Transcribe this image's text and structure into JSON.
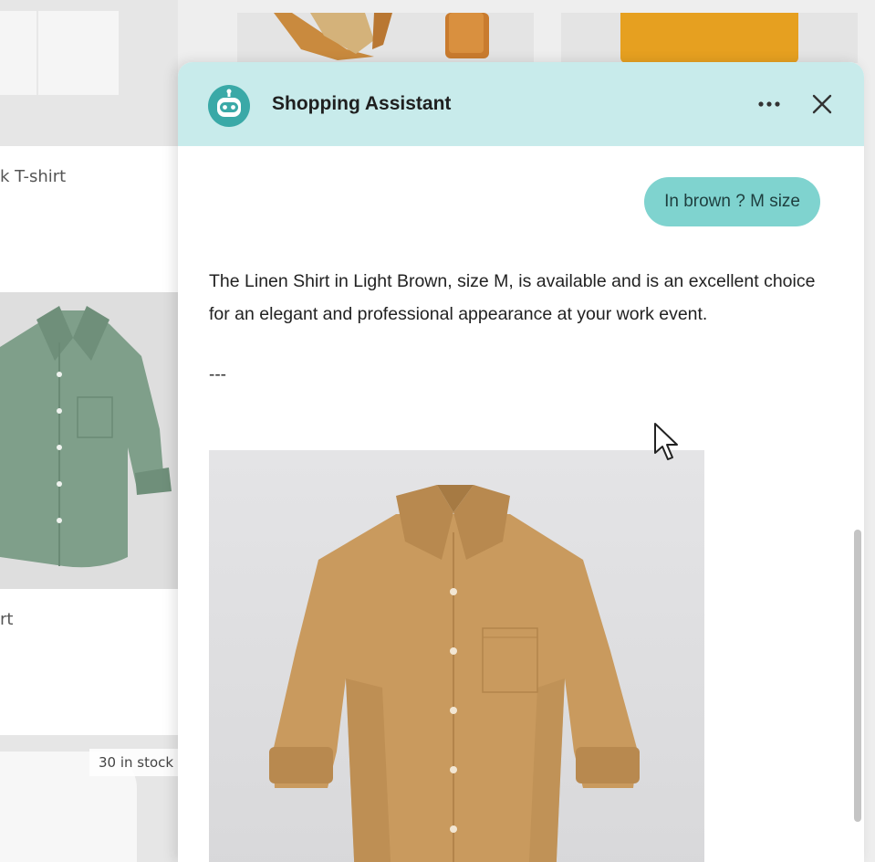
{
  "background": {
    "label_tshirt": "k T-shirt",
    "label_shirt": "rt",
    "stock_badge": "30 in stock"
  },
  "chat": {
    "title": "Shopping Assistant",
    "avatar_icon": "robot-icon",
    "more_icon": "more-horizontal-icon",
    "close_icon": "close-icon",
    "user_message": "In brown ? M size",
    "assistant_message": "The Linen Shirt in Light Brown, size M, is available and is an excellent choice for an elegant and professional appearance at your work event.",
    "separator": "---",
    "product_image_alt": "Linen Shirt in Light Brown"
  },
  "colors": {
    "header_bg": "#c8ebeb",
    "avatar_bg": "#3aa9a7",
    "user_bubble": "#7fd3cf",
    "shirt_brown": "#c99a5e",
    "shirt_green": "#7f9f8a"
  }
}
